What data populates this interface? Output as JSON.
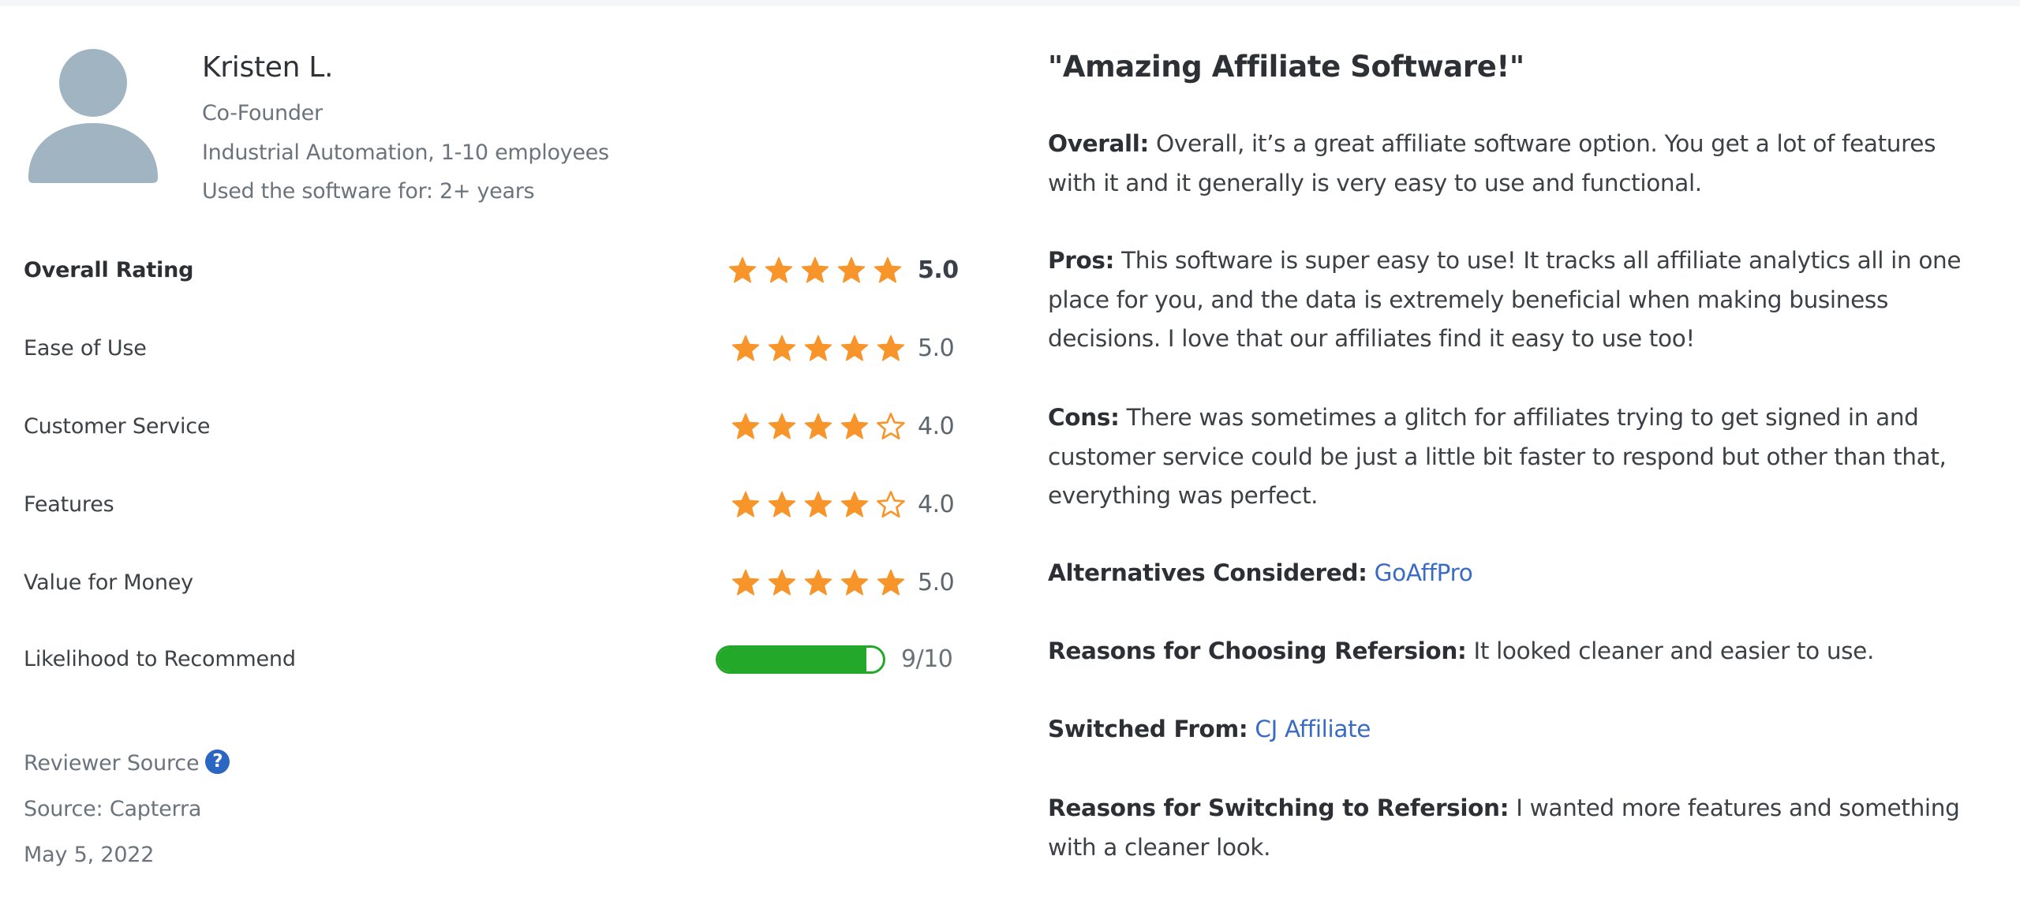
{
  "reviewer": {
    "avatar_icon": "user-silhouette-icon",
    "name": "Kristen L.",
    "role": "Co-Founder",
    "company": "Industrial Automation, 1-10 employees",
    "usage": "Used the software for: 2+ years"
  },
  "ratings": [
    {
      "label": "Overall Rating",
      "value": "5.0",
      "stars": 5,
      "max": 5
    },
    {
      "label": "Ease of Use",
      "value": "5.0",
      "stars": 5,
      "max": 5
    },
    {
      "label": "Customer Service",
      "value": "4.0",
      "stars": 4,
      "max": 5
    },
    {
      "label": "Features",
      "value": "4.0",
      "stars": 4,
      "max": 5
    },
    {
      "label": "Value for Money",
      "value": "5.0",
      "stars": 5,
      "max": 5
    }
  ],
  "recommend": {
    "label": "Likelihood to Recommend",
    "score": 9,
    "max": 10,
    "value_text": "9/10"
  },
  "source": {
    "label": "Reviewer Source",
    "help_icon": "question-mark-circle-icon",
    "help_glyph": "?",
    "source_text": "Source: Capterra",
    "date": "May 5, 2022"
  },
  "review": {
    "title": "\"Amazing Affiliate Software!\"",
    "overall_label": "Overall:",
    "overall_text": "Overall, it’s a great affiliate software option. You get a lot of features with it and it generally is very easy to use and functional.",
    "pros_label": "Pros:",
    "pros_text": "This software is super easy to use! It tracks all affiliate analytics all in one place for you, and the data is extremely beneficial when making business decisions. I love that our affiliates find it easy to use too!",
    "cons_label": "Cons:",
    "cons_text": "There was sometimes a glitch for affiliates trying to get signed in and customer service could be just a little bit faster to respond but other than that, everything was perfect.",
    "alternatives_label": "Alternatives Considered:",
    "alternatives_link": "GoAffPro",
    "choosing_label": "Reasons for Choosing Refersion:",
    "choosing_text": "It looked cleaner and easier to use.",
    "switched_label": "Switched From:",
    "switched_link": "CJ Affiliate",
    "switching_label": "Reasons for Switching to Refersion:",
    "switching_text": "I wanted more features and something with a cleaner look."
  },
  "colors": {
    "star": "#f7952b",
    "progress": "#24a829",
    "link": "#3a6bc4",
    "help_icon": "#2a66c2",
    "avatar": "#a1b4c2"
  }
}
